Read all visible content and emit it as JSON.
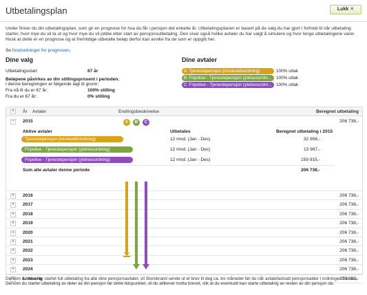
{
  "header": {
    "title": "Utbetalingsplan",
    "close_label": "Lukk ✕"
  },
  "intro": {
    "text": "Under finner du din utbetalingsplan, som gir en prognose for hva du får i pensjon det enkelte år. Utbetalingsplanen er basert på de valg du har gjort i forhold til når utbetaling starter, hvor mye du vil ta ut og hvor mye du vil jobbe etter start av pensjonsutbetaling. Den viser også hvilke avtaler du har valgt å simulere og hvor lenge utbetalingene varer. Husk at dette er en prognose og at fremtidige utbetalte beløp derfor kan avvike fra de som er oppgitt her.",
    "prereq_prefix": "Se ",
    "prereq_link": "forutsetninger for prognosen",
    "prereq_suffix": "."
  },
  "choices": {
    "heading": "Dine valg",
    "start_label": "Utbetalingsstart",
    "start_value": "67 år",
    "affected_text": "Beløpene påvirkes av din stillingsprosent i perioden.",
    "basis_text": "I denne beregningen er følgende lagt til grunn:",
    "from_now_label": "Fra nå til du er 67 år:",
    "from_now_value": "100% stilling",
    "from_67_label": "Fra du er 67 år:",
    "from_67_value": "0% stilling"
  },
  "agreements": {
    "heading": "Dine avtaler",
    "items": [
      {
        "letter": "A",
        "label": "Tjenestepensjon (innskuddsordning)",
        "pct": "100% uttak"
      },
      {
        "letter": "B",
        "label": "Fripolise - Tjenestepensjon (ytelsesordni...",
        "pct": "100% uttak"
      },
      {
        "letter": "C",
        "label": "Fripolise - Tjenestepensjon (ytelsesordni...",
        "pct": "100% uttak"
      }
    ]
  },
  "colors": {
    "a": "#d9a21b",
    "b": "#7aa83a",
    "c": "#8e4cc0",
    "accent": "#1a62a8"
  },
  "table": {
    "col_year": "År",
    "col_agreements": "Avtaler",
    "col_change": "Endringsbeskrivelse",
    "col_amount": "Beregnet utbetaling",
    "expanded": {
      "year": "2015",
      "amount": "206 738,-",
      "head_agreements": "Aktive avtaler",
      "head_paid": "Utbetales",
      "head_amount": "Beregnet utbetaling i 2015",
      "lines": [
        {
          "label": "Tjenestepensjon (innskuddsordning)",
          "paid": "12 mnd. (Jan - Des)",
          "amount": "32 856,-"
        },
        {
          "label": "Fripolise - Tjenestepensjon (ytelsesordning)",
          "paid": "12 mnd. (Jan - Des)",
          "amount": "13 967,-"
        },
        {
          "label": "Fripolise - Tjenestepensjon (ytelsesordning)",
          "paid": "12 mnd. (Jan - Des)",
          "amount": "159 915,-"
        }
      ],
      "sum_label": "Sum alle avtaler denne periode",
      "sum_amount": "206 738,-"
    },
    "rows": [
      {
        "year": "2016",
        "amount": "206 738,-"
      },
      {
        "year": "2017",
        "amount": "206 738,-"
      },
      {
        "year": "2018",
        "amount": "206 738,-"
      },
      {
        "year": "2019",
        "amount": "206 738,-"
      },
      {
        "year": "2020",
        "amount": "206 738,-"
      },
      {
        "year": "2021",
        "amount": "206 738,-"
      },
      {
        "year": "2022",
        "amount": "206 738,-"
      },
      {
        "year": "2023",
        "amount": "206 738,-"
      },
      {
        "year": "2024",
        "amount": "206 738,-"
      },
      {
        "year": "Livsvarig",
        "amount": "173 882,-"
      }
    ]
  },
  "footer": {
    "text": "Dersom du ikke har startet full utbetaling fra alle dine pensjonsavtaler, vil Storebrand sende ut et brev til deg ca. tre måneder før du når avtalefastsatt pensjonsalder i ordninger hos oss. Dersom du starter utbetaling av deler av din pensjon før dette tidspunktet, vil du allikevel motta brevet, slik at du eventuelt kan starte utbetaling av resten av din pensjon da."
  }
}
